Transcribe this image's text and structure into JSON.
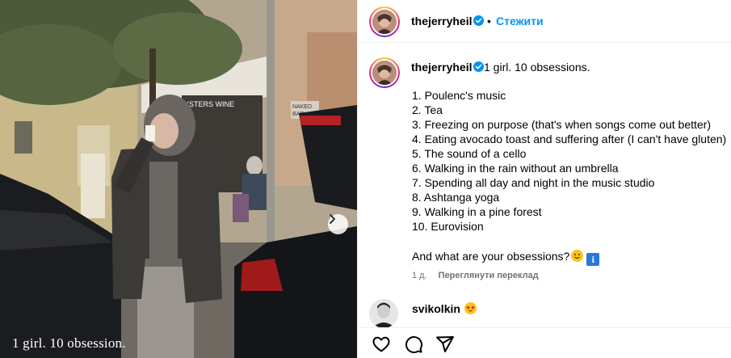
{
  "post": {
    "image_caption": "1 girl. 10 obsession.",
    "author": "thejerryheil",
    "follow_label": "Стежити",
    "separator": "•",
    "caption_first_line": "1 girl. 10 obsessions.",
    "list": [
      "1. Poulenc's music",
      "2. Tea",
      "3. Freezing on purpose (that's when songs come out better)",
      "4. Eating avocado toast and suffering after (I can't have gluten)",
      "5. The sound of a cello",
      "6. Walking in the rain without an umbrella",
      "7. Spending all day and night in the music studio",
      "8. Ashtanga yoga",
      "9. Walking in a pine forest",
      "10. Eurovision"
    ],
    "question": "And what are your obsessions?",
    "info_emoji": "i",
    "time_ago": "1 д.",
    "translate_label": "Переглянути переклад"
  },
  "comment": {
    "username": "svikolkin"
  },
  "icons": {
    "like": "heart-icon",
    "comment": "comment-icon",
    "share": "share-icon",
    "next": "chevron-right-icon",
    "verified": "verified-badge-icon"
  },
  "colors": {
    "accent": "#0095f6",
    "verified": "#0095f6",
    "muted": "#737373",
    "emoji_yellow": "#fcc21b",
    "info_blue": "#2878d8"
  }
}
